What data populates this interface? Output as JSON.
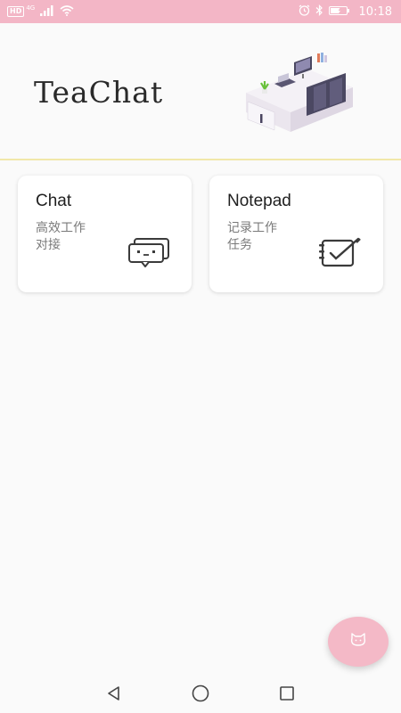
{
  "status_bar": {
    "hd": "HD",
    "network": "4G",
    "time": "10:18",
    "icons": [
      "signal-icon",
      "wifi-icon",
      "alarm-icon",
      "bluetooth-icon",
      "battery-icon"
    ]
  },
  "header": {
    "title": "TeaChat"
  },
  "cards": [
    {
      "title": "Chat",
      "desc_line1": "高效工作",
      "desc_line2": "对接",
      "icon": "chat-bubble-icon"
    },
    {
      "title": "Notepad",
      "desc_line1": "记录工作",
      "desc_line2": "任务",
      "icon": "notepad-icon"
    }
  ],
  "fab": {
    "icon": "cat-face-icon"
  },
  "nav": {
    "items": [
      "back-icon",
      "home-icon",
      "recents-icon"
    ]
  },
  "colors": {
    "status_bar": "#f3b6c6",
    "divider": "#f1e7a9",
    "fab": "#f4b9c7",
    "background": "#fafafa"
  }
}
